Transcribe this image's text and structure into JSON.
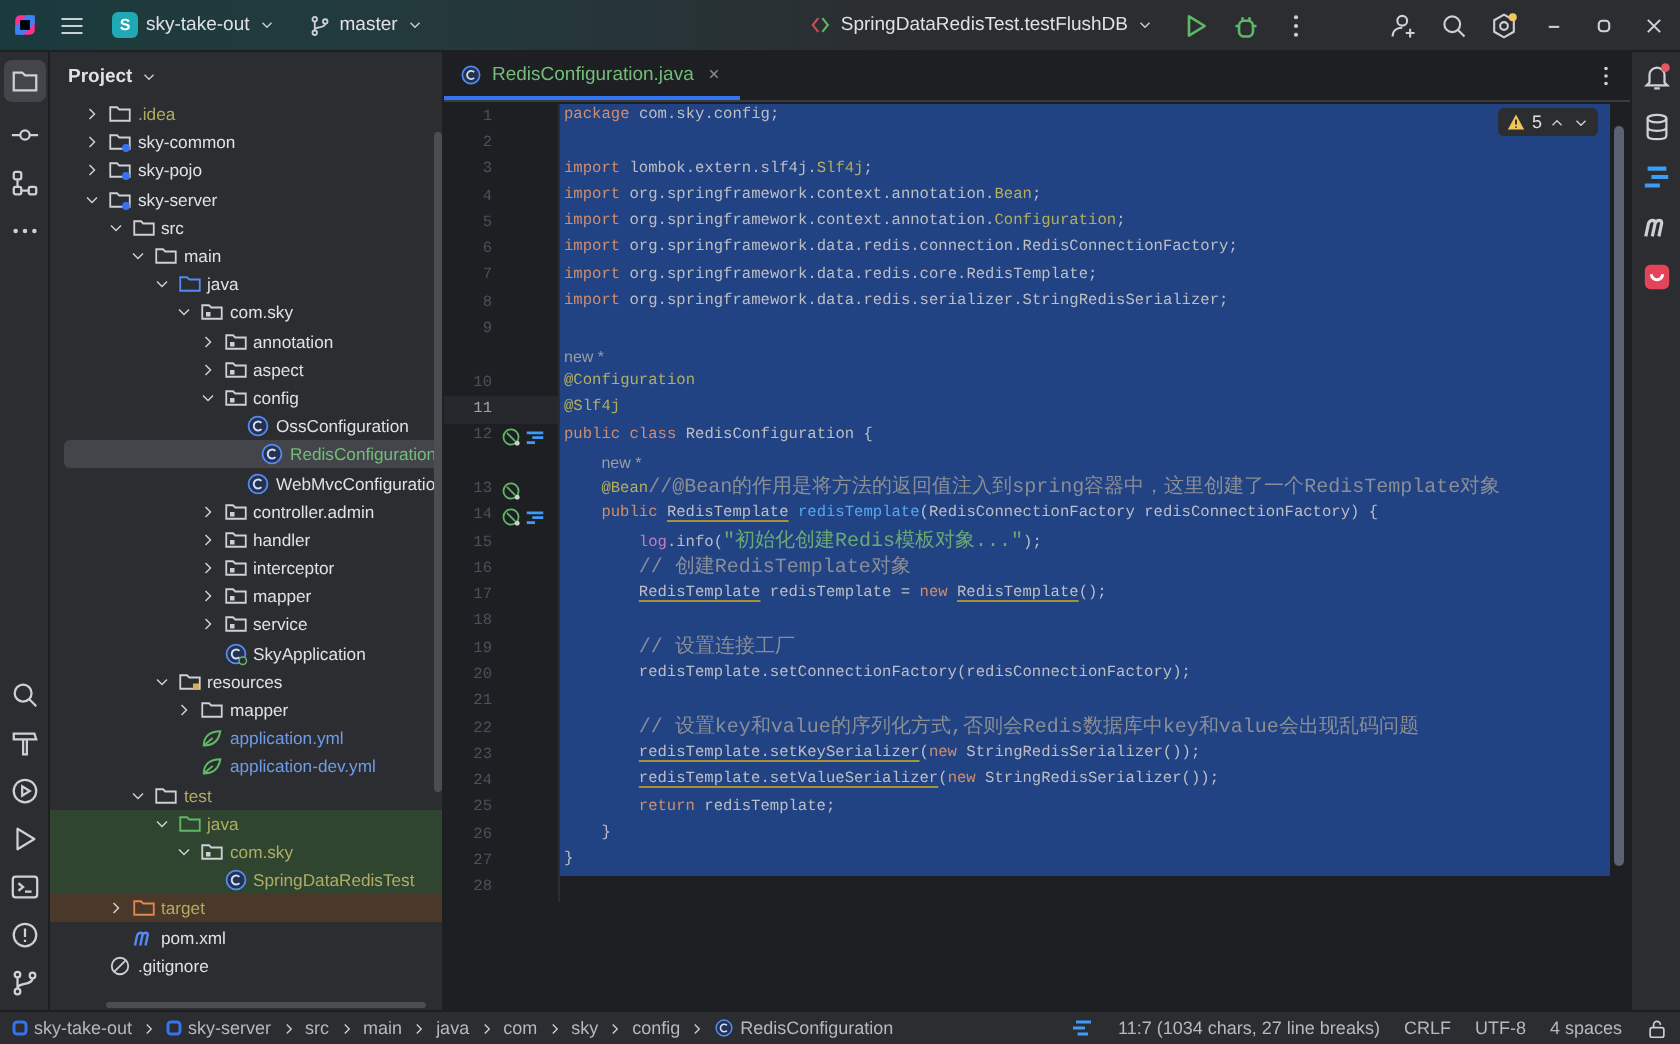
{
  "toolbar": {
    "project_badge": "S",
    "project": "sky-take-out",
    "branch": "master",
    "run_config": "SpringDataRedisTest.testFlushDB"
  },
  "project_panel": {
    "title": "Project",
    "tree": [
      {
        "name": ".idea",
        "kind": "folder",
        "color": "#b0ad62",
        "test_source": false,
        "excluded": false,
        "selected": false,
        "expanded": false
      },
      {
        "name": "sky-common",
        "kind": "module",
        "color": "#dfe1e5",
        "test_source": false,
        "excluded": false,
        "selected": false,
        "expanded": false
      },
      {
        "name": "sky-pojo",
        "kind": "module",
        "color": "#dfe1e5",
        "test_source": false,
        "excluded": false,
        "selected": false,
        "expanded": false
      },
      {
        "name": "sky-server",
        "kind": "module",
        "color": "#dfe1e5",
        "test_source": false,
        "excluded": false,
        "selected": false,
        "expanded": true,
        "children": [
          {
            "name": "src",
            "kind": "folder",
            "color": "#dfe1e5",
            "test_source": false,
            "excluded": false,
            "selected": false,
            "expanded": true,
            "children": [
              {
                "name": "main",
                "kind": "folder",
                "color": "#dfe1e5",
                "test_source": false,
                "excluded": false,
                "selected": false,
                "expanded": true,
                "children": [
                  {
                    "name": "java",
                    "kind": "source-root",
                    "color": "#dfe1e5",
                    "test_source": false,
                    "excluded": false,
                    "selected": false,
                    "expanded": true,
                    "children": [
                      {
                        "name": "com.sky",
                        "kind": "package",
                        "color": "#dfe1e5",
                        "test_source": false,
                        "excluded": false,
                        "selected": false,
                        "expanded": true,
                        "children": [
                          {
                            "name": "annotation",
                            "kind": "package",
                            "color": "#dfe1e5",
                            "test_source": false,
                            "excluded": false,
                            "selected": false,
                            "expanded": false
                          },
                          {
                            "name": "aspect",
                            "kind": "package",
                            "color": "#dfe1e5",
                            "test_source": false,
                            "excluded": false,
                            "selected": false,
                            "expanded": false
                          },
                          {
                            "name": "config",
                            "kind": "package",
                            "color": "#dfe1e5",
                            "test_source": false,
                            "excluded": false,
                            "selected": false,
                            "expanded": true,
                            "children": [
                              {
                                "name": "OssConfiguration",
                                "kind": "class",
                                "color": "#dfe1e5",
                                "test_source": false,
                                "excluded": false,
                                "selected": false
                              },
                              {
                                "name": "RedisConfiguration",
                                "kind": "class",
                                "color": "#73bd79",
                                "test_source": false,
                                "excluded": false,
                                "selected": true
                              },
                              {
                                "name": "WebMvcConfiguratio",
                                "kind": "class",
                                "color": "#dfe1e5",
                                "test_source": false,
                                "excluded": false,
                                "selected": false
                              }
                            ]
                          },
                          {
                            "name": "controller.admin",
                            "kind": "package",
                            "color": "#dfe1e5",
                            "test_source": false,
                            "excluded": false,
                            "selected": false,
                            "expanded": false
                          },
                          {
                            "name": "handler",
                            "kind": "package",
                            "color": "#dfe1e5",
                            "test_source": false,
                            "excluded": false,
                            "selected": false,
                            "expanded": false
                          },
                          {
                            "name": "interceptor",
                            "kind": "package",
                            "color": "#dfe1e5",
                            "test_source": false,
                            "excluded": false,
                            "selected": false,
                            "expanded": false
                          },
                          {
                            "name": "mapper",
                            "kind": "package",
                            "color": "#dfe1e5",
                            "test_source": false,
                            "excluded": false,
                            "selected": false,
                            "expanded": false
                          },
                          {
                            "name": "service",
                            "kind": "package",
                            "color": "#dfe1e5",
                            "test_source": false,
                            "excluded": false,
                            "selected": false,
                            "expanded": false
                          },
                          {
                            "name": "SkyApplication",
                            "kind": "boot-class",
                            "color": "#dfe1e5",
                            "test_source": false,
                            "excluded": false,
                            "selected": false
                          }
                        ]
                      }
                    ]
                  },
                  {
                    "name": "resources",
                    "kind": "resources-root",
                    "color": "#dfe1e5",
                    "test_source": false,
                    "excluded": false,
                    "selected": false,
                    "expanded": true,
                    "children": [
                      {
                        "name": "mapper",
                        "kind": "folder",
                        "color": "#dfe1e5",
                        "test_source": false,
                        "excluded": false,
                        "selected": false,
                        "expanded": false
                      },
                      {
                        "name": "application.yml",
                        "kind": "yml",
                        "color": "#6f9ce8",
                        "test_source": false,
                        "excluded": false,
                        "selected": false
                      },
                      {
                        "name": "application-dev.yml",
                        "kind": "yml",
                        "color": "#6f9ce8",
                        "test_source": false,
                        "excluded": false,
                        "selected": false
                      }
                    ]
                  }
                ]
              },
              {
                "name": "test",
                "kind": "folder",
                "color": "#b0ad62",
                "test_source": false,
                "excluded": false,
                "selected": false,
                "expanded": true,
                "children": [
                  {
                    "name": "java",
                    "kind": "test-root",
                    "color": "#b0ad62",
                    "test_source": true,
                    "excluded": false,
                    "selected": false,
                    "expanded": true,
                    "children": [
                      {
                        "name": "com.sky",
                        "kind": "package",
                        "color": "#b0ad62",
                        "test_source": true,
                        "excluded": false,
                        "selected": false,
                        "expanded": true,
                        "children": [
                          {
                            "name": "SpringDataRedisTest",
                            "kind": "class",
                            "color": "#b0ad62",
                            "test_source": true,
                            "excluded": false,
                            "selected": false
                          }
                        ]
                      }
                    ]
                  }
                ]
              }
            ]
          },
          {
            "name": "target",
            "kind": "excluded-folder",
            "color": "#b0ad62",
            "test_source": false,
            "excluded": true,
            "selected": false,
            "expanded": false
          },
          {
            "name": "pom.xml",
            "kind": "maven",
            "color": "#dfe1e5",
            "test_source": false,
            "excluded": false,
            "selected": false
          }
        ]
      },
      {
        "name": ".gitignore",
        "kind": "git",
        "color": "#dfe1e5",
        "test_source": false,
        "excluded": false,
        "selected": false
      }
    ]
  },
  "editor": {
    "tabs": [
      {
        "label": "RedisConfiguration.java",
        "selected": true
      }
    ],
    "warnings": "5",
    "lines": [
      {
        "kind": "code",
        "number": "1",
        "selected": true,
        "current": false,
        "tokens": [
          {
            "kind": "kw",
            "text": "package"
          },
          {
            "kind": "plain",
            "text": " com.sky.config;"
          }
        ]
      },
      {
        "kind": "code",
        "number": "2",
        "selected": true,
        "current": false
      },
      {
        "kind": "code",
        "number": "3",
        "selected": true,
        "current": false,
        "tokens": [
          {
            "kind": "kw",
            "text": "import"
          },
          {
            "kind": "plain",
            "text": " lombok.extern.slf4j."
          },
          {
            "kind": "cls",
            "text": "Slf4j"
          },
          {
            "kind": "plain",
            "text": ";"
          }
        ]
      },
      {
        "kind": "code",
        "number": "4",
        "selected": true,
        "current": false,
        "tokens": [
          {
            "kind": "kw",
            "text": "import"
          },
          {
            "kind": "plain",
            "text": " org.springframework.context.annotation."
          },
          {
            "kind": "cls",
            "text": "Bean"
          },
          {
            "kind": "plain",
            "text": ";"
          }
        ]
      },
      {
        "kind": "code",
        "number": "5",
        "selected": true,
        "current": false,
        "tokens": [
          {
            "kind": "kw",
            "text": "import"
          },
          {
            "kind": "plain",
            "text": " org.springframework.context.annotation."
          },
          {
            "kind": "cls",
            "text": "Configuration"
          },
          {
            "kind": "plain",
            "text": ";"
          }
        ]
      },
      {
        "kind": "code",
        "number": "6",
        "selected": true,
        "current": false,
        "tokens": [
          {
            "kind": "kw",
            "text": "import"
          },
          {
            "kind": "plain",
            "text": " org.springframework.data.redis.connection.RedisConnectionFactory;"
          }
        ]
      },
      {
        "kind": "code",
        "number": "7",
        "selected": true,
        "current": false,
        "tokens": [
          {
            "kind": "kw",
            "text": "import"
          },
          {
            "kind": "plain",
            "text": " org.springframework.data.redis.core.RedisTemplate;"
          }
        ]
      },
      {
        "kind": "code",
        "number": "8",
        "selected": true,
        "current": false,
        "tokens": [
          {
            "kind": "kw",
            "text": "import"
          },
          {
            "kind": "plain",
            "text": " org.springframework.data.redis.serializer.StringRedisSerializer;"
          }
        ]
      },
      {
        "kind": "code",
        "number": "9",
        "selected": true,
        "current": false
      },
      {
        "kind": "hint",
        "text": "new *",
        "selected": true,
        "current": false
      },
      {
        "kind": "code",
        "number": "10",
        "selected": true,
        "current": false,
        "tokens": [
          {
            "kind": "ann",
            "text": "@Configuration"
          }
        ]
      },
      {
        "kind": "code",
        "number": "11",
        "selected": true,
        "current": true,
        "tokens": [
          {
            "kind": "ann",
            "text": "@Slf4j"
          }
        ]
      },
      {
        "kind": "code",
        "number": "12",
        "selected": true,
        "current": false,
        "gutter": [
          {
            "kind": "bean"
          },
          {
            "kind": "implemented"
          }
        ],
        "tokens": [
          {
            "kind": "kw",
            "text": "public class"
          },
          {
            "kind": "plain",
            "text": " RedisConfiguration {"
          }
        ]
      },
      {
        "kind": "member-hint",
        "text": "new *",
        "selected": true,
        "current": false
      },
      {
        "kind": "member",
        "number": "13",
        "selected": true,
        "current": false,
        "gutter": [
          {
            "kind": "bean"
          }
        ],
        "tokens": [
          {
            "kind": "ann",
            "text": "@Bean"
          },
          {
            "kind": "cmt",
            "text": "//@Bean的作用是将方法的返回值注入到spring容器中，这里创建了一个RedisTemplate对象"
          }
        ]
      },
      {
        "kind": "member",
        "number": "14",
        "selected": true,
        "current": false,
        "gutter": [
          {
            "kind": "bean"
          },
          {
            "kind": "implemented"
          }
        ],
        "tokens": [
          {
            "kind": "kw",
            "text": "public "
          },
          {
            "kind": "warn",
            "text": "RedisTemplate"
          },
          {
            "kind": "fn",
            "text": " redisTemplate"
          },
          {
            "kind": "plain",
            "text": "(RedisConnectionFactory redisConnectionFactory) {"
          }
        ]
      },
      {
        "kind": "statement",
        "number": "15",
        "selected": true,
        "current": false,
        "tokens": [
          {
            "kind": "field",
            "text": "log"
          },
          {
            "kind": "plain",
            "text": ".info("
          },
          {
            "kind": "str",
            "text": "\"初始化创建Redis模板对象...\""
          },
          {
            "kind": "plain",
            "text": ");"
          }
        ]
      },
      {
        "kind": "statement",
        "number": "16",
        "selected": true,
        "current": false,
        "tokens": [
          {
            "kind": "cmt",
            "text": "// 创建RedisTemplate对象"
          }
        ]
      },
      {
        "kind": "statement",
        "number": "17",
        "selected": true,
        "current": false,
        "tokens": [
          {
            "kind": "warn",
            "text": "RedisTemplate"
          },
          {
            "kind": "plain",
            "text": " redisTemplate = "
          },
          {
            "kind": "kw",
            "text": "new "
          },
          {
            "kind": "warn",
            "text": "RedisTemplate"
          },
          {
            "kind": "plain",
            "text": "();"
          }
        ]
      },
      {
        "kind": "code",
        "number": "18",
        "selected": true,
        "current": false
      },
      {
        "kind": "statement",
        "number": "19",
        "selected": true,
        "current": false,
        "tokens": [
          {
            "kind": "cmt",
            "text": "// 设置连接工厂"
          }
        ]
      },
      {
        "kind": "statement",
        "number": "20",
        "selected": true,
        "current": false,
        "tokens": [
          {
            "kind": "plain",
            "text": "redisTemplate.setConnectionFactory(redisConnectionFactory);"
          }
        ]
      },
      {
        "kind": "code",
        "number": "21",
        "selected": true,
        "current": false
      },
      {
        "kind": "statement",
        "number": "22",
        "selected": true,
        "current": false,
        "tokens": [
          {
            "kind": "cmt",
            "text": "// 设置key和value的序列化方式,否则会Redis数据库中key和value会出现乱码问题"
          }
        ]
      },
      {
        "kind": "statement",
        "number": "23",
        "selected": true,
        "current": false,
        "tokens": [
          {
            "kind": "warn",
            "text": "redisTemplate.setKeySerializer"
          },
          {
            "kind": "plain",
            "text": "("
          },
          {
            "kind": "kw",
            "text": "new"
          },
          {
            "kind": "plain",
            "text": " StringRedisSerializer());"
          }
        ]
      },
      {
        "kind": "statement",
        "number": "24",
        "selected": true,
        "current": false,
        "tokens": [
          {
            "kind": "warn",
            "text": "redisTemplate.setValueSerializer"
          },
          {
            "kind": "plain",
            "text": "("
          },
          {
            "kind": "kw",
            "text": "new"
          },
          {
            "kind": "plain",
            "text": " StringRedisSerializer());"
          }
        ]
      },
      {
        "kind": "statement",
        "number": "25",
        "selected": true,
        "current": false,
        "tokens": [
          {
            "kind": "kw",
            "text": "return"
          },
          {
            "kind": "plain",
            "text": " redisTemplate;"
          }
        ]
      },
      {
        "kind": "member",
        "number": "26",
        "selected": true,
        "current": false,
        "tokens": [
          {
            "kind": "plain",
            "text": "}"
          }
        ]
      },
      {
        "kind": "code",
        "number": "27",
        "selected": true,
        "current": false,
        "tokens": [
          {
            "kind": "plain",
            "text": "}"
          }
        ]
      },
      {
        "kind": "code",
        "number": "28",
        "selected": false,
        "current": false
      }
    ]
  },
  "status_bar": {
    "breadcrumbs": [
      {
        "label": "sky-take-out",
        "kind": "module"
      },
      {
        "label": "sky-server",
        "kind": "module"
      },
      {
        "label": "src",
        "kind": "plain"
      },
      {
        "label": "main",
        "kind": "plain"
      },
      {
        "label": "java",
        "kind": "plain"
      },
      {
        "label": "com",
        "kind": "plain"
      },
      {
        "label": "sky",
        "kind": "plain"
      },
      {
        "label": "config",
        "kind": "plain"
      },
      {
        "label": "RedisConfiguration",
        "kind": "class"
      }
    ],
    "position": "11:7 (1034 chars, 27 line breaks)",
    "line_separator": "CRLF",
    "encoding": "UTF-8",
    "indent": "4 spaces"
  }
}
